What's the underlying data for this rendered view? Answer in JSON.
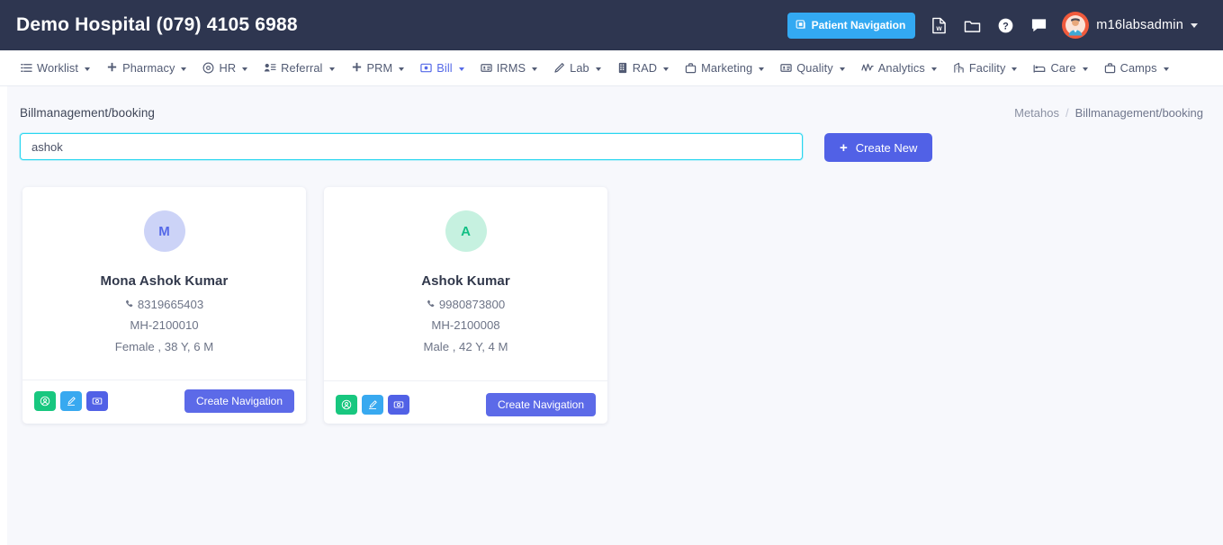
{
  "header": {
    "brand_title": "Demo Hospital (079) 4105 6988",
    "patient_navigation_label": "Patient Navigation",
    "patient_navigation_icon": "patient-navigation-icon",
    "icons": [
      {
        "name": "word-document-icon"
      },
      {
        "name": "folder-icon"
      },
      {
        "name": "help-circle-icon"
      },
      {
        "name": "chat-bubble-icon"
      }
    ],
    "avatar_icon": "user-avatar",
    "username": "m16labsadmin",
    "brand_bg": "#2e3650",
    "patient_nav_bg": "#33a9f2",
    "avatar_bg": "#f05a3c"
  },
  "nav": {
    "active_color": "#5569e8",
    "items": [
      {
        "label": "Worklist",
        "icon": "list-icon",
        "active": false
      },
      {
        "label": "Pharmacy",
        "icon": "plus-icon",
        "active": false
      },
      {
        "label": "HR",
        "icon": "at-circle-icon",
        "active": false
      },
      {
        "label": "Referral",
        "icon": "user-list-icon",
        "active": false
      },
      {
        "label": "PRM",
        "icon": "plus-icon",
        "active": false
      },
      {
        "label": "Bill",
        "icon": "bill-card-icon",
        "active": true
      },
      {
        "label": "IRMS",
        "icon": "id-card-icon",
        "active": false
      },
      {
        "label": "Lab",
        "icon": "pencil-icon",
        "active": false
      },
      {
        "label": "RAD",
        "icon": "building-icon",
        "active": false
      },
      {
        "label": "Marketing",
        "icon": "briefcase-icon",
        "active": false
      },
      {
        "label": "Quality",
        "icon": "id-card-icon",
        "active": false
      },
      {
        "label": "Analytics",
        "icon": "pulse-icon",
        "active": false
      },
      {
        "label": "Facility",
        "icon": "office-icon",
        "active": false
      },
      {
        "label": "Care",
        "icon": "bed-icon",
        "active": false
      },
      {
        "label": "Camps",
        "icon": "suitcase-icon",
        "active": false
      }
    ]
  },
  "page": {
    "title": "Billmanagement/booking",
    "breadcrumb_root": "Metahos",
    "breadcrumb_separator": "/",
    "breadcrumb_current": "Billmanagement/booking"
  },
  "toolbar": {
    "search_value": "ashok",
    "search_placeholder": "",
    "create_new_label": "Create New",
    "create_new_icon": "plus-icon",
    "create_new_bg": "#5161e6",
    "search_border": "#29d6f0"
  },
  "patients": [
    {
      "initial": "M",
      "avatar_bg": "#ccd3f7",
      "avatar_fg": "#5569e8",
      "name": "Mona Ashok Kumar",
      "phone": "8319665403",
      "phone_icon": "phone-icon",
      "mrn": "MH-2100010",
      "demographics": "Female , 38 Y, 6 M",
      "actions": [
        {
          "name": "patient-profile-button",
          "icon": "user-circle-icon",
          "color": "#18c77f"
        },
        {
          "name": "edit-patient-button",
          "icon": "pencil-icon",
          "color": "#38a9f0"
        },
        {
          "name": "patient-card-button",
          "icon": "id-photo-icon",
          "color": "#5161e6"
        }
      ],
      "create_navigation_label": "Create Navigation"
    },
    {
      "initial": "A",
      "avatar_bg": "#c6f1e0",
      "avatar_fg": "#12bf84",
      "name": "Ashok Kumar",
      "phone": "9980873800",
      "phone_icon": "phone-icon",
      "mrn": "MH-2100008",
      "demographics": "Male , 42 Y, 4 M",
      "actions": [
        {
          "name": "patient-profile-button",
          "icon": "user-circle-icon",
          "color": "#18c77f"
        },
        {
          "name": "edit-patient-button",
          "icon": "pencil-icon",
          "color": "#38a9f0"
        },
        {
          "name": "patient-card-button",
          "icon": "id-photo-icon",
          "color": "#5161e6"
        }
      ],
      "create_navigation_label": "Create Navigation"
    }
  ]
}
